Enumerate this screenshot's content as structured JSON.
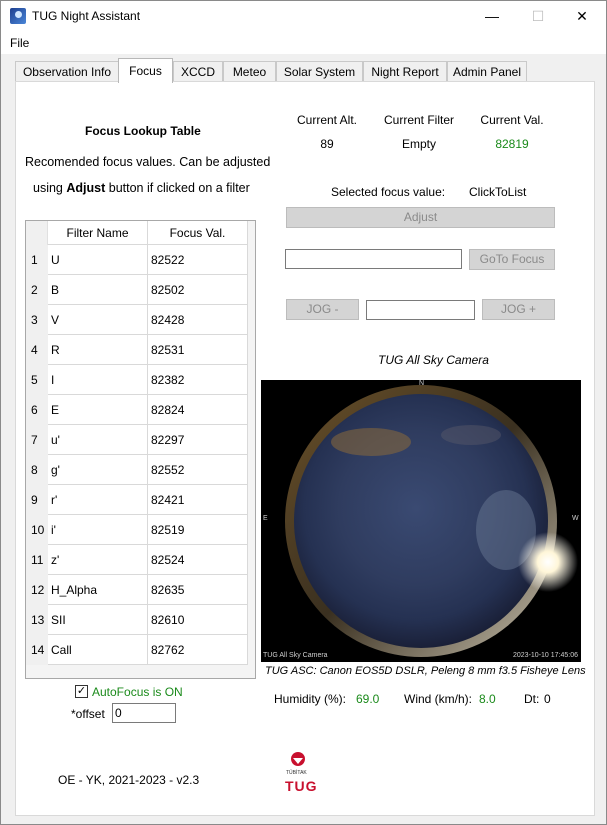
{
  "window": {
    "title": "TUG Night Assistant",
    "minimize": "—",
    "maximize": "☐",
    "close": "✕"
  },
  "menu": {
    "file": "File"
  },
  "tabs": [
    "Observation Info",
    "Focus",
    "XCCD",
    "Meteo",
    "Solar System",
    "Night Report",
    "Admin Panel"
  ],
  "active_tab": "Focus",
  "focus": {
    "lookup_title": "Focus Lookup Table",
    "description_line1": "Recomended focus values. Can be adjusted",
    "desc_using": "using",
    "desc_adjust": "Adjust",
    "desc_rest": "button if clicked on a filter",
    "table": {
      "col_filter": "Filter Name",
      "col_focus": "Focus Val.",
      "rows": [
        {
          "n": "1",
          "filter": "U",
          "value": "82522"
        },
        {
          "n": "2",
          "filter": "B",
          "value": "82502"
        },
        {
          "n": "3",
          "filter": "V",
          "value": "82428"
        },
        {
          "n": "4",
          "filter": "R",
          "value": "82531"
        },
        {
          "n": "5",
          "filter": "I",
          "value": "82382"
        },
        {
          "n": "6",
          "filter": "E",
          "value": "82824"
        },
        {
          "n": "7",
          "filter": "u'",
          "value": "82297"
        },
        {
          "n": "8",
          "filter": "g'",
          "value": "82552"
        },
        {
          "n": "9",
          "filter": "r'",
          "value": "82421"
        },
        {
          "n": "10",
          "filter": "i'",
          "value": "82519"
        },
        {
          "n": "11",
          "filter": "z'",
          "value": "82524"
        },
        {
          "n": "12",
          "filter": "H_Alpha",
          "value": "82635"
        },
        {
          "n": "13",
          "filter": "SII",
          "value": "82610"
        },
        {
          "n": "14",
          "filter": "Call",
          "value": "82762"
        }
      ]
    },
    "autofocus_checked": true,
    "autofocus_label": "AutoFocus is ON",
    "offset_label": "*offset",
    "offset_value": "0",
    "current_alt_label": "Current Alt.",
    "current_alt_value": "89",
    "current_filter_label": "Current Filter",
    "current_filter_value": "Empty",
    "current_val_label": "Current Val.",
    "current_val_value": "82819",
    "selected_focus_label": "Selected focus value:",
    "selected_focus_value": "ClickToList",
    "adjust_button": "Adjust",
    "goto_value": "",
    "goto_button": "GoTo Focus",
    "jog_minus": "JOG -",
    "jog_value": "",
    "jog_plus": "JOG +"
  },
  "sky_camera": {
    "title": "TUG All Sky Camera",
    "label_n": "N",
    "label_e": "E",
    "label_w": "W",
    "watermark": "TUG All Sky Camera",
    "timestamp": "2023-10-10 17:45:06",
    "caption": "TUG ASC: Canon EOS5D DSLR, Peleng 8 mm f3.5 Fisheye Lens"
  },
  "weather": {
    "humidity_label": "Humidity (%):",
    "humidity_value": "69.0",
    "wind_label": "Wind (km/h):",
    "wind_value": "8.0",
    "dt_label": "Dt:",
    "dt_value": "0"
  },
  "footer": {
    "version": "OE - YK, 2021-2023 - v2.3",
    "logo_top": "TÜBİTAK",
    "logo_text": "TUG"
  },
  "colors": {
    "green_value": "#1a8a1a",
    "logo_red": "#c8102e"
  }
}
